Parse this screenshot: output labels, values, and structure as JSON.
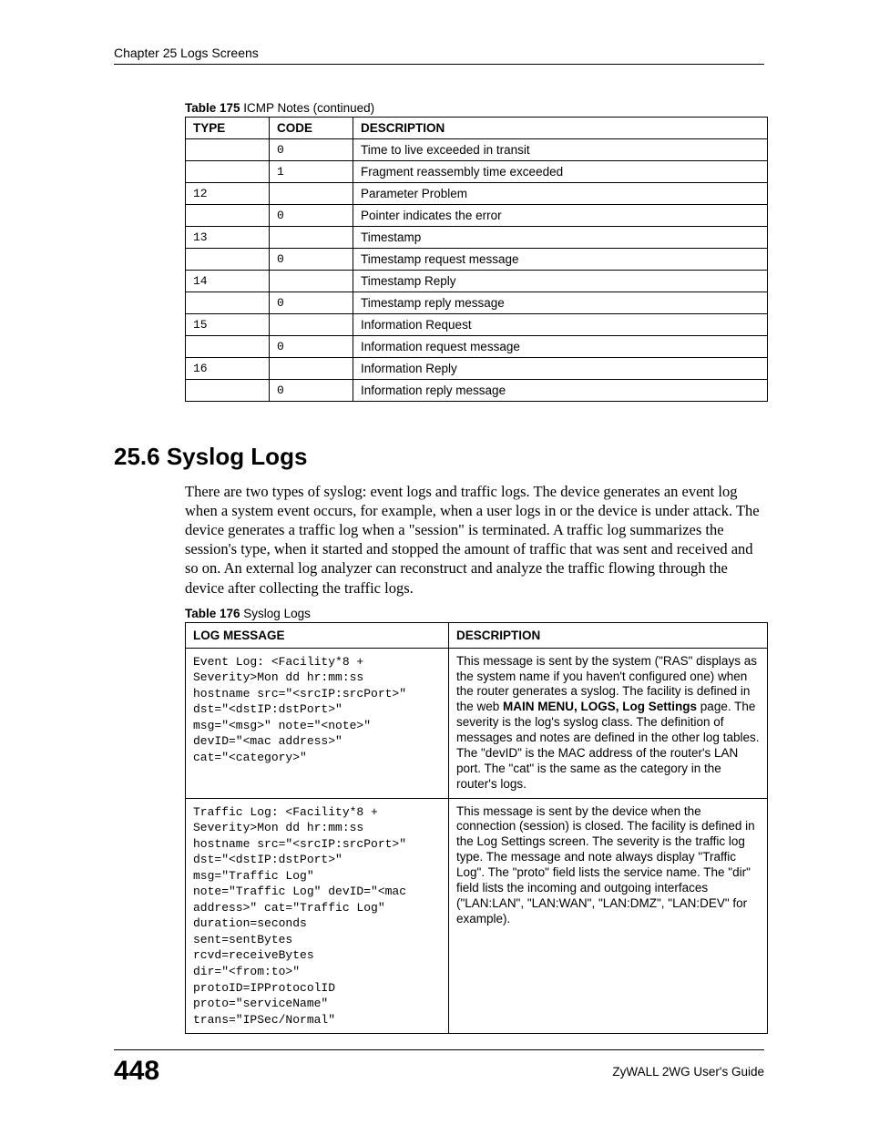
{
  "header": {
    "chapter": "Chapter 25 Logs Screens"
  },
  "table175": {
    "caption_bold": "Table 175",
    "caption_rest": "   ICMP Notes (continued)",
    "headers": {
      "type": "TYPE",
      "code": "CODE",
      "desc": "DESCRIPTION"
    },
    "rows": [
      {
        "type": "",
        "code": "0",
        "desc": "Time to live exceeded in transit"
      },
      {
        "type": "",
        "code": "1",
        "desc": "Fragment reassembly time exceeded"
      },
      {
        "type": "12",
        "code": "",
        "desc": "Parameter Problem"
      },
      {
        "type": "",
        "code": "0",
        "desc": "Pointer indicates the error"
      },
      {
        "type": "13",
        "code": "",
        "desc": "Timestamp"
      },
      {
        "type": "",
        "code": "0",
        "desc": "Timestamp request message"
      },
      {
        "type": "14",
        "code": "",
        "desc": "Timestamp Reply"
      },
      {
        "type": "",
        "code": "0",
        "desc": "Timestamp reply message"
      },
      {
        "type": "15",
        "code": "",
        "desc": "Information Request"
      },
      {
        "type": "",
        "code": "0",
        "desc": "Information request message"
      },
      {
        "type": "16",
        "code": "",
        "desc": "Information Reply"
      },
      {
        "type": "",
        "code": "0",
        "desc": "Information reply message"
      }
    ]
  },
  "section": {
    "title": "25.6  Syslog Logs",
    "paragraph": "There are two types of syslog: event logs and traffic logs. The device generates an event log when a system event occurs, for example, when a user logs in or the device is under attack. The device generates a traffic log when a \"session\" is terminated. A traffic log summarizes the session's type, when it started and stopped the amount of traffic that was sent and received and so on.  An external log analyzer can reconstruct and analyze the traffic flowing through the device after collecting the traffic logs."
  },
  "table176": {
    "caption_bold": "Table 176",
    "caption_rest": "   Syslog Logs",
    "headers": {
      "log": "LOG MESSAGE",
      "desc": "DESCRIPTION"
    },
    "rows": [
      {
        "log": "Event Log: <Facility*8 +\nSeverity>Mon dd hr:mm:ss\nhostname src=\"<srcIP:srcPort>\"\ndst=\"<dstIP:dstPort>\"\nmsg=\"<msg>\" note=\"<note>\"\ndevID=\"<mac address>\"\ncat=\"<category>\"",
        "desc_pre": "This message is sent by the system (\"RAS\" displays as the system name if you haven't configured one) when the router generates a syslog. The facility is defined in the web ",
        "desc_bold": "MAIN MENU, LOGS, Log Settings",
        "desc_post": " page. The severity is the log's syslog class. The definition of messages and notes are defined in the other log tables. The \"devID\" is the MAC address of the router's LAN port. The \"cat\" is the same as the category in the router's logs."
      },
      {
        "log": "Traffic Log: <Facility*8 +\nSeverity>Mon dd hr:mm:ss\nhostname src=\"<srcIP:srcPort>\"\ndst=\"<dstIP:dstPort>\"\nmsg=\"Traffic Log\"\nnote=\"Traffic Log\" devID=\"<mac\naddress>\" cat=\"Traffic Log\"\nduration=seconds\nsent=sentBytes\nrcvd=receiveBytes\ndir=\"<from:to>\"\nprotoID=IPProtocolID\nproto=\"serviceName\"\ntrans=\"IPSec/Normal\"",
        "desc_pre": "This message is sent by the device when the connection (session) is closed. The facility is defined in the Log Settings screen. The severity is the traffic log type. The message and note always display \"Traffic Log\". The \"proto\" field lists the service name. The \"dir\" field lists the incoming and outgoing interfaces (\"LAN:LAN\", \"LAN:WAN\", \"LAN:DMZ\", \"LAN:DEV\" for example).",
        "desc_bold": "",
        "desc_post": ""
      }
    ]
  },
  "footer": {
    "page": "448",
    "guide": "ZyWALL 2WG User's Guide"
  }
}
